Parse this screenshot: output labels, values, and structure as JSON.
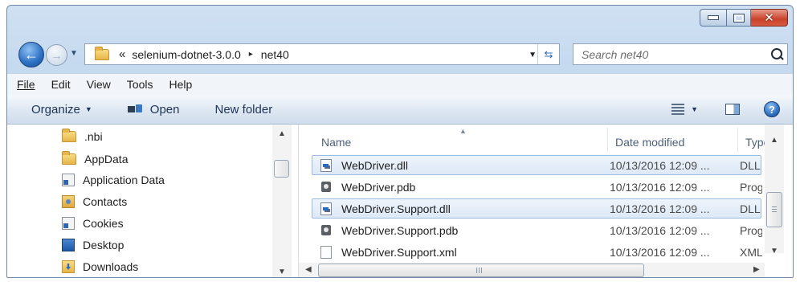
{
  "window": {
    "caption_buttons": {
      "minimize_icon": "minimize-icon",
      "maximize_icon": "maximize-icon",
      "close_glyph": "✕"
    }
  },
  "address": {
    "overflow_chevron": "«",
    "breadcrumbs": [
      "selenium-dotnet-3.0.0",
      "net40"
    ],
    "separator_arrow": "▸"
  },
  "search": {
    "placeholder": "Search net40"
  },
  "menu": {
    "file": "File",
    "edit": "Edit",
    "view": "View",
    "tools": "Tools",
    "help": "Help"
  },
  "toolbar": {
    "organize": "Organize",
    "open": "Open",
    "new_folder": "New folder",
    "help_glyph": "?"
  },
  "nav_pane": {
    "items": [
      {
        "label": ".nbi",
        "icon": "folder-icon"
      },
      {
        "label": "AppData",
        "icon": "folder-icon"
      },
      {
        "label": "Application Data",
        "icon": "shortcut-folder-icon"
      },
      {
        "label": "Contacts",
        "icon": "contacts-icon"
      },
      {
        "label": "Cookies",
        "icon": "shortcut-folder-icon"
      },
      {
        "label": "Desktop",
        "icon": "desktop-icon"
      },
      {
        "label": "Downloads",
        "icon": "downloads-icon"
      }
    ]
  },
  "file_list": {
    "columns": {
      "name": "Name",
      "date": "Date modified",
      "type": "Type"
    },
    "rows": [
      {
        "name": "WebDriver.dll",
        "date": "10/13/2016 12:09 ...",
        "type": "DLL I",
        "icon": "dll-file-icon",
        "selected": true
      },
      {
        "name": "WebDriver.pdb",
        "date": "10/13/2016 12:09 ...",
        "type": "Prog",
        "icon": "pdb-file-icon",
        "selected": false
      },
      {
        "name": "WebDriver.Support.dll",
        "date": "10/13/2016 12:09 ...",
        "type": "DLL I",
        "icon": "dll-file-icon",
        "selected": true
      },
      {
        "name": "WebDriver.Support.pdb",
        "date": "10/13/2016 12:09 ...",
        "type": "Prog",
        "icon": "pdb-file-icon",
        "selected": false
      },
      {
        "name": "WebDriver.Support.xml",
        "date": "10/13/2016 12:09 ...",
        "type": "XML",
        "icon": "xml-file-icon",
        "selected": false
      }
    ]
  },
  "colors": {
    "accent": "#2b6fc2",
    "selection": "#dde9f6",
    "chrome": "#bcd3ec"
  }
}
